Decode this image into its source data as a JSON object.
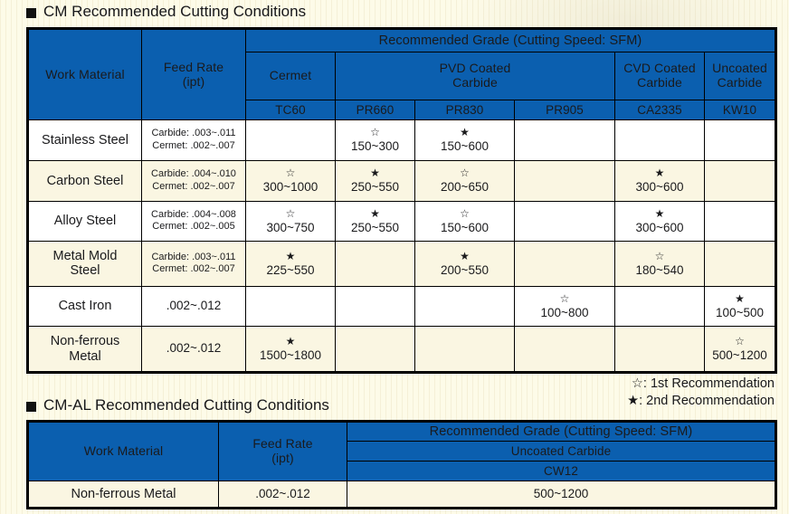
{
  "sections": {
    "cm": {
      "title": "CM Recommended Cutting Conditions",
      "headers": {
        "work_material": "Work Material",
        "feed_rate": "Feed Rate\n(ipt)",
        "recommended_grade": "Recommended Grade (Cutting Speed: SFM)",
        "groups": [
          {
            "label": "Cermet",
            "grades": [
              "TC60"
            ]
          },
          {
            "label": "PVD Coated\nCarbide",
            "grades": [
              "PR660",
              "PR830",
              "PR905"
            ]
          },
          {
            "label": "CVD Coated\nCarbide",
            "grades": [
              "CA2335"
            ]
          },
          {
            "label": "Uncoated\nCarbide",
            "grades": [
              "KW10"
            ]
          }
        ],
        "grade_names": [
          "TC60",
          "PR660",
          "PR830",
          "PR905",
          "CA2335",
          "KW10"
        ]
      },
      "rows": [
        {
          "material": "Stainless Steel",
          "feed": "Carbide: .003~.011\nCermet: .002~.007",
          "feed_small": true,
          "cells": [
            {
              "star": "",
              "range": ""
            },
            {
              "star": "☆",
              "range": "150~300"
            },
            {
              "star": "★",
              "range": "150~600"
            },
            {
              "star": "",
              "range": ""
            },
            {
              "star": "",
              "range": ""
            },
            {
              "star": "",
              "range": ""
            }
          ]
        },
        {
          "material": "Carbon Steel",
          "feed": "Carbide: .004~.010\nCermet: .002~.007",
          "feed_small": true,
          "cells": [
            {
              "star": "☆",
              "range": "300~1000"
            },
            {
              "star": "★",
              "range": "250~550"
            },
            {
              "star": "☆",
              "range": "200~650"
            },
            {
              "star": "",
              "range": ""
            },
            {
              "star": "★",
              "range": "300~600"
            },
            {
              "star": "",
              "range": ""
            }
          ]
        },
        {
          "material": "Alloy Steel",
          "feed": "Carbide: .004~.008\nCermet: .002~.005",
          "feed_small": true,
          "cells": [
            {
              "star": "☆",
              "range": "300~750"
            },
            {
              "star": "★",
              "range": "250~550"
            },
            {
              "star": "☆",
              "range": "150~600"
            },
            {
              "star": "",
              "range": ""
            },
            {
              "star": "★",
              "range": "300~600"
            },
            {
              "star": "",
              "range": ""
            }
          ]
        },
        {
          "material": "Metal Mold\nSteel",
          "feed": "Carbide: .003~.011\nCermet: .002~.007",
          "feed_small": true,
          "cells": [
            {
              "star": "★",
              "range": "225~550"
            },
            {
              "star": "",
              "range": ""
            },
            {
              "star": "★",
              "range": "200~550"
            },
            {
              "star": "",
              "range": ""
            },
            {
              "star": "☆",
              "range": "180~540"
            },
            {
              "star": "",
              "range": ""
            }
          ]
        },
        {
          "material": "Cast Iron",
          "feed": ".002~.012",
          "feed_small": false,
          "cells": [
            {
              "star": "",
              "range": ""
            },
            {
              "star": "",
              "range": ""
            },
            {
              "star": "",
              "range": ""
            },
            {
              "star": "☆",
              "range": "100~800"
            },
            {
              "star": "",
              "range": ""
            },
            {
              "star": "★",
              "range": "100~500"
            }
          ]
        },
        {
          "material": "Non-ferrous\nMetal",
          "feed": ".002~.012",
          "feed_small": false,
          "cells": [
            {
              "star": "★",
              "range": "1500~1800"
            },
            {
              "star": "",
              "range": ""
            },
            {
              "star": "",
              "range": ""
            },
            {
              "star": "",
              "range": ""
            },
            {
              "star": "",
              "range": ""
            },
            {
              "star": "☆",
              "range": "500~1200"
            }
          ]
        }
      ]
    },
    "legend": {
      "first": "☆: 1st Recommendation",
      "second": "★: 2nd Recommendation"
    },
    "cmal": {
      "title": "CM-AL Recommended Cutting Conditions",
      "headers": {
        "work_material": "Work Material",
        "feed_rate": "Feed Rate\n(ipt)",
        "recommended_grade": "Recommended Grade (Cutting Speed: SFM)",
        "group": "Uncoated Carbide",
        "grade": "CW12"
      },
      "rows": [
        {
          "material": "Non-ferrous Metal",
          "feed": ".002~.012",
          "value": "500~1200"
        }
      ]
    }
  },
  "colors": {
    "header_blue": "#0b5faf",
    "band_alt": "#faf6e2",
    "page_bg": "#fdfbe8",
    "border": "#000000"
  }
}
